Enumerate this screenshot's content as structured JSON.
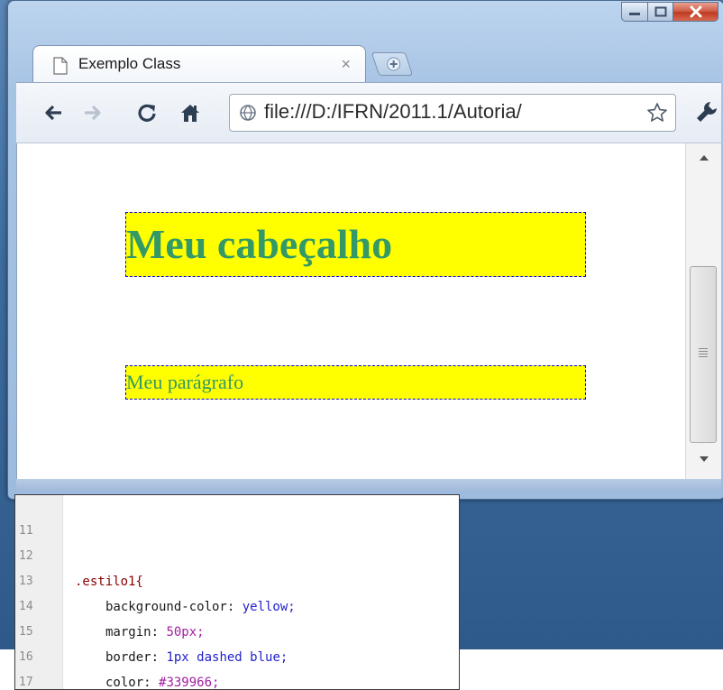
{
  "browser": {
    "tab_title": "Exemplo Class",
    "tab_close_glyph": "×",
    "address": "file:///D:/IFRN/2011.1/Autoria/",
    "icons": {
      "back": "back-arrow-icon",
      "forward": "forward-arrow-icon",
      "reload": "reload-icon",
      "home": "home-icon",
      "bookmark": "star-icon",
      "settings": "wrench-icon",
      "new_tab": "plus-icon",
      "page": "page-icon"
    }
  },
  "page": {
    "heading": "Meu cabeçalho",
    "paragraph": "Meu parágrafo",
    "style": {
      "background": "yellow",
      "border_color": "blue",
      "text_color": "#339966"
    }
  },
  "editor": {
    "lines": [
      {
        "n": "11",
        "text": ""
      },
      {
        "n": "12",
        "text": ".estilo1{"
      },
      {
        "n": "13",
        "prop": "background-color: ",
        "value": "yellow;"
      },
      {
        "n": "14",
        "prop": "margin: ",
        "value": "50px;"
      },
      {
        "n": "15",
        "prop": "border: ",
        "value": "1px dashed blue;"
      },
      {
        "n": "16",
        "prop": "color: ",
        "value": "#339966;"
      },
      {
        "n": "17",
        "text": "}"
      }
    ]
  }
}
